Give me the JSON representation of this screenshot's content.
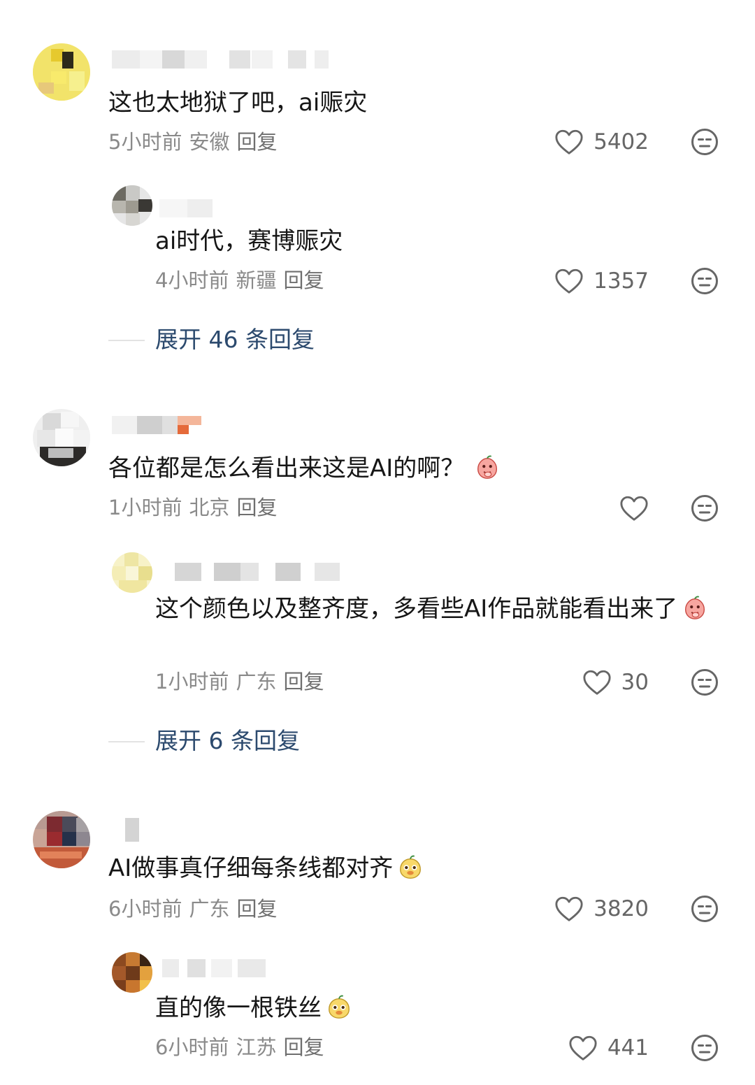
{
  "comments": [
    {
      "text": "这也太地狱了吧，ai赈灾",
      "time": "5小时前",
      "location": "安徽",
      "reply_label": "回复",
      "likes": "5402",
      "replies": [
        {
          "text": "ai时代，赛博赈灾",
          "time": "4小时前",
          "location": "新疆",
          "reply_label": "回复",
          "likes": "1357"
        }
      ],
      "expand_label": "展开 46 条回复"
    },
    {
      "text": "各位都是怎么看出来这是AI的啊？",
      "emoji": "peach-shy-emoji",
      "time": "1小时前",
      "location": "北京",
      "reply_label": "回复",
      "likes": "",
      "replies": [
        {
          "text": "这个颜色以及整齐度，多看些AI作品就能看出来了",
          "emoji": "peach-shy-emoji",
          "time": "1小时前",
          "location": "广东",
          "reply_label": "回复",
          "likes": "30"
        }
      ],
      "expand_label": "展开 6 条回复"
    },
    {
      "text": "AI做事真仔细每条线都对齐",
      "emoji": "yellow-face-emoji",
      "time": "6小时前",
      "location": "广东",
      "reply_label": "回复",
      "likes": "3820",
      "replies": [
        {
          "text": "直的像一根铁丝",
          "emoji": "yellow-face-emoji",
          "time": "6小时前",
          "location": "江苏",
          "reply_label": "回复",
          "likes": "441"
        }
      ]
    }
  ],
  "colors": {
    "text": "#161616",
    "meta": "#8a8a8a",
    "expand": "#2c4a6e",
    "icon": "#666666"
  }
}
